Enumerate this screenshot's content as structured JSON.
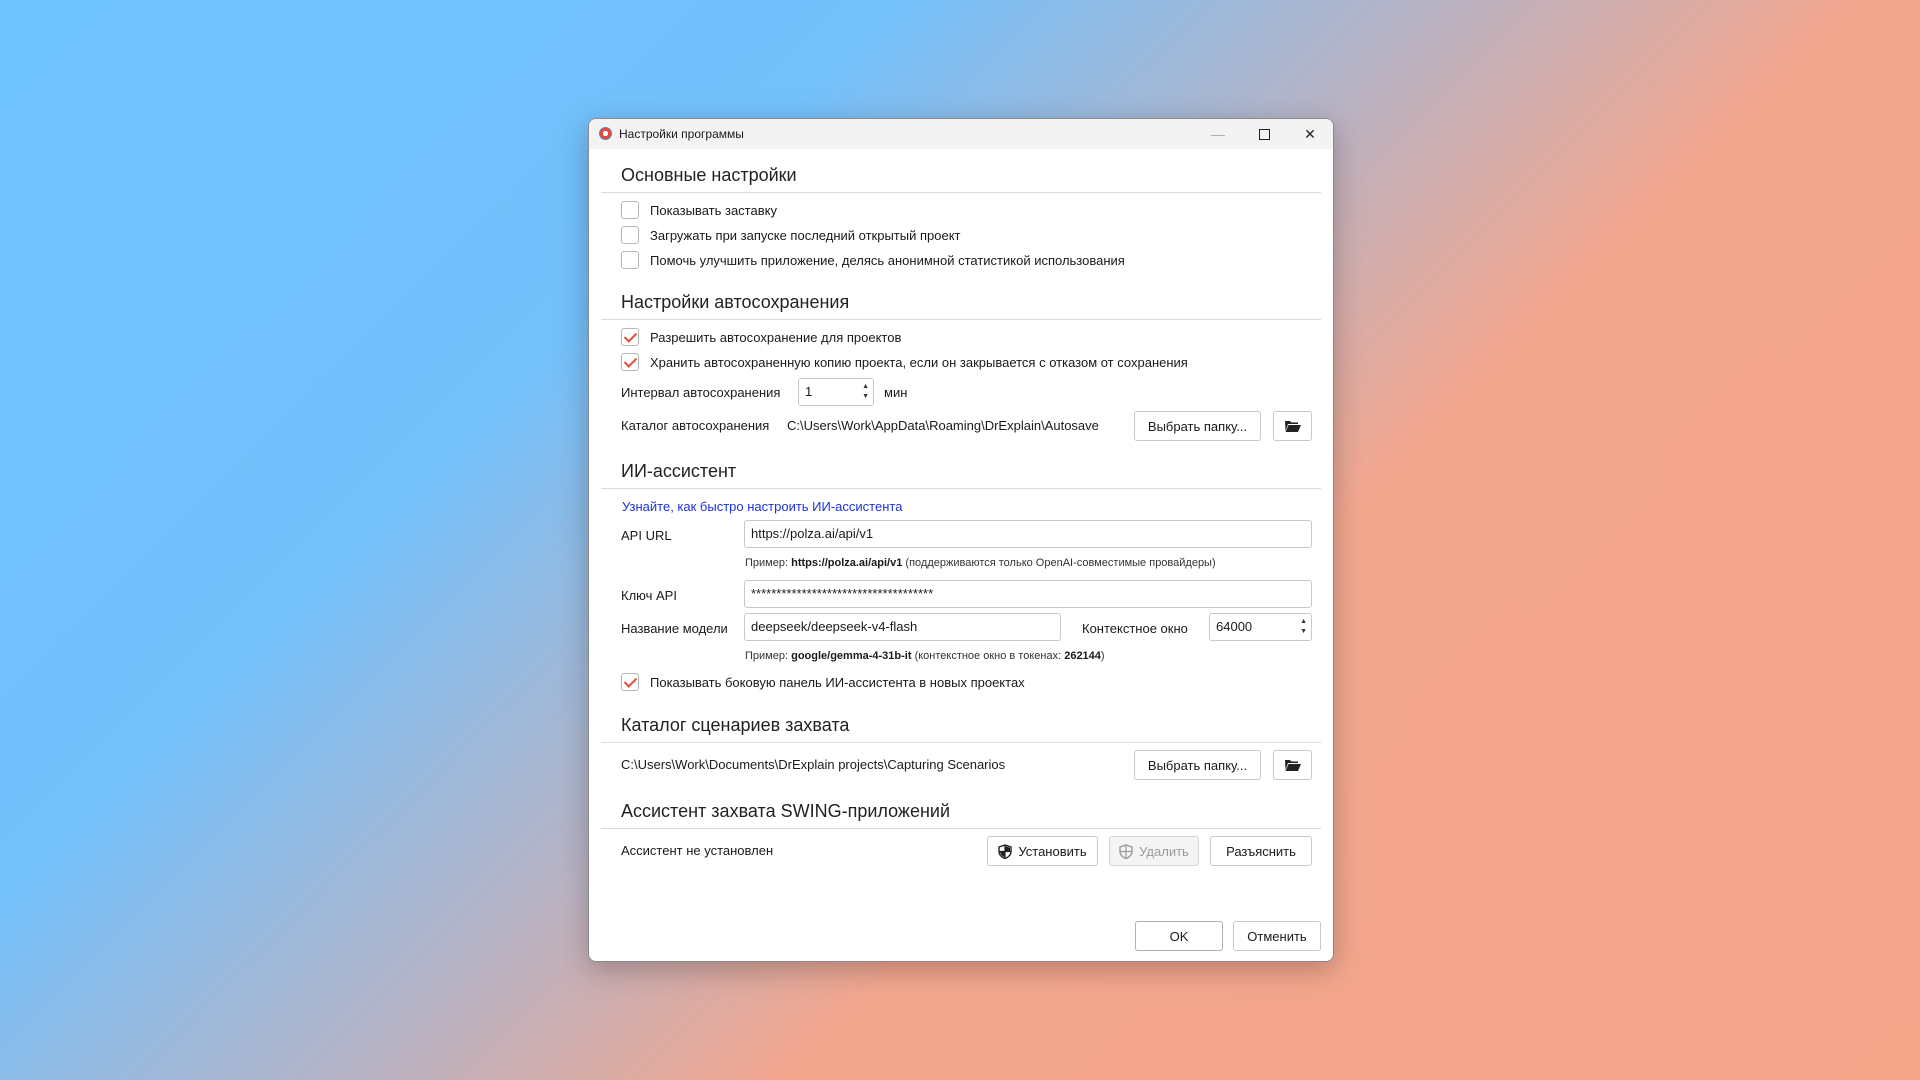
{
  "window": {
    "title": "Настройки программы"
  },
  "general": {
    "title": "Основные настройки",
    "options": [
      {
        "label": "Показывать заставку",
        "checked": false
      },
      {
        "label": "Загружать при запуске последний открытый проект",
        "checked": false
      },
      {
        "label": "Помочь улучшить приложение, делясь анонимной статистикой использования",
        "checked": false
      }
    ]
  },
  "autosave": {
    "title": "Настройки автосохранения",
    "options": [
      {
        "label": "Разрешить автосохранение для проектов",
        "checked": true
      },
      {
        "label": "Хранить автосохраненную копию проекта, если он закрывается с отказом от сохранения",
        "checked": true
      }
    ],
    "interval_label": "Интервал автосохранения",
    "interval_value": "1",
    "interval_unit": "мин",
    "dir_label": "Каталог автосохранения",
    "dir_path": "C:\\Users\\Work\\AppData\\Roaming\\DrExplain\\Autosave",
    "choose_folder": "Выбрать папку..."
  },
  "ai": {
    "title": "ИИ-ассистент",
    "help_link": "Узнайте, как быстро настроить ИИ-ассистента",
    "api_url_label": "API URL",
    "api_url_value": "https://polza.ai/api/v1",
    "api_url_hint_prefix": "Пример:",
    "api_url_hint_example": "https://polza.ai/api/v1",
    "api_url_hint_suffix": "(поддерживаются только OpenAI-совместимые провайдеры)",
    "api_key_label": "Ключ API",
    "api_key_value": "************************************",
    "model_label": "Название модели",
    "model_value": "deepseek/deepseek-v4-flash",
    "context_label": "Контекстное окно",
    "context_value": "64000",
    "model_hint_prefix": "Пример:",
    "model_hint_example": "google/gemma-4-31b-it",
    "model_hint_mid": "(контекстное окно в токенах:",
    "model_hint_tokens": "262144",
    "model_hint_end": ")",
    "show_panel_label": "Показывать боковую панель ИИ-ассистента в новых проектах",
    "show_panel_checked": true
  },
  "capture": {
    "title": "Каталог сценариев захвата",
    "path": "C:\\Users\\Work\\Documents\\DrExplain projects\\Capturing Scenarios",
    "choose_folder": "Выбрать папку..."
  },
  "swing": {
    "title": "Ассистент захвата SWING-приложений",
    "status": "Ассистент не установлен",
    "install": "Установить",
    "remove": "Удалить",
    "explain": "Разъяснить"
  },
  "footer": {
    "ok": "OK",
    "cancel": "Отменить"
  },
  "colors": {
    "check": "#e0503a",
    "link": "#1d33e0"
  }
}
